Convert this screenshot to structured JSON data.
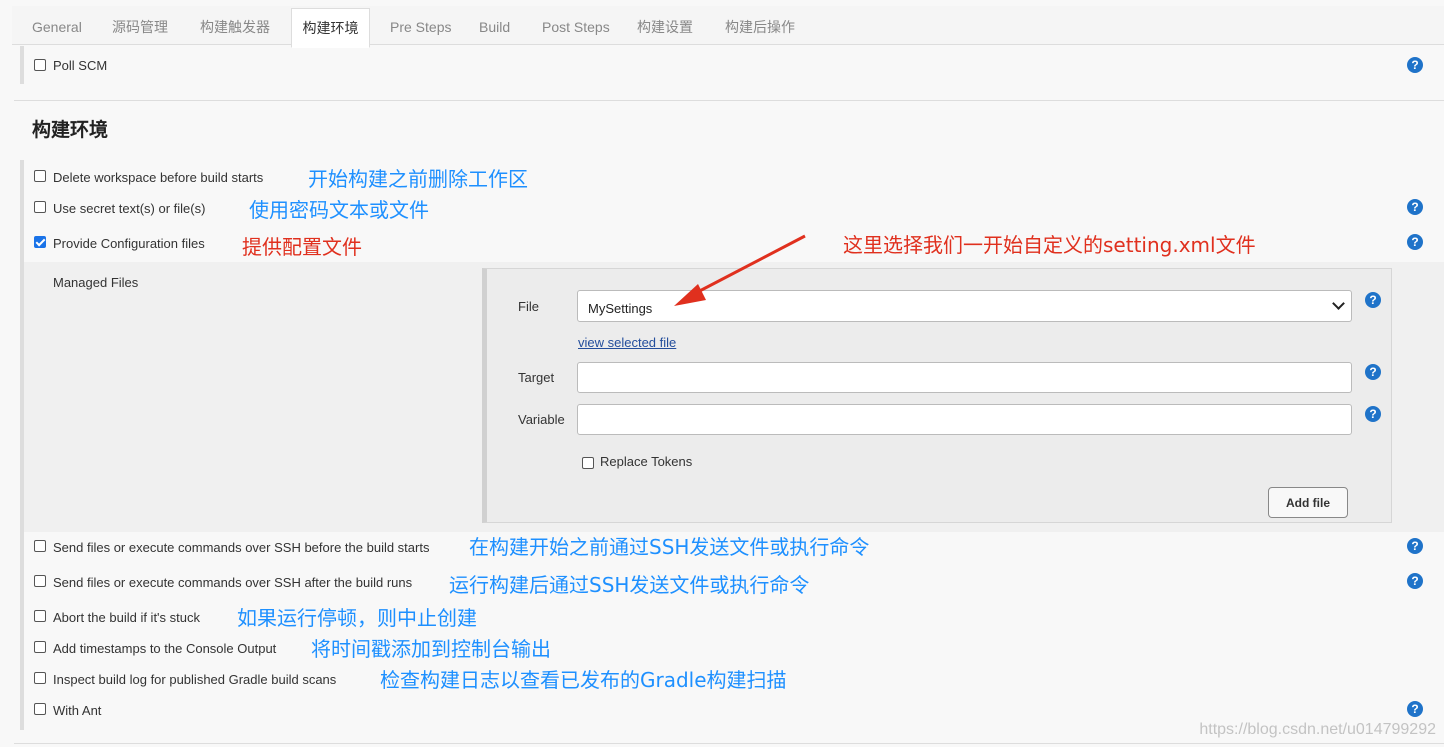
{
  "tabs": [
    "General",
    "源码管理",
    "构建触发器",
    "构建环境",
    "Pre Steps",
    "Build",
    "Post Steps",
    "构建设置",
    "构建后操作"
  ],
  "active_tab": "构建环境",
  "poll_scm": {
    "label": "Poll SCM",
    "checked": false
  },
  "section_title": "构建环境",
  "options": [
    {
      "label": "Delete workspace before build starts",
      "checked": false,
      "annotation": "开始构建之前删除工作区",
      "help": false
    },
    {
      "label": "Use secret text(s) or file(s)",
      "checked": false,
      "annotation": "使用密码文本或文件",
      "help": true
    },
    {
      "label": "Provide Configuration files",
      "checked": true,
      "annotation": "提供配置文件",
      "help": true
    },
    {
      "label": "Send files or execute commands over SSH before the build starts",
      "checked": false,
      "annotation": "在构建开始之前通过SSH发送文件或执行命令",
      "help": true
    },
    {
      "label": "Send files or execute commands over SSH after the build runs",
      "checked": false,
      "annotation": "运行构建后通过SSH发送文件或执行命令",
      "help": true
    },
    {
      "label": "Abort the build if it's stuck",
      "checked": false,
      "annotation": "如果运行停顿，则中止创建",
      "help": false
    },
    {
      "label": "Add timestamps to the Console Output",
      "checked": false,
      "annotation": "将时间戳添加到控制台输出",
      "help": false
    },
    {
      "label": "Inspect build log for published Gradle build scans",
      "checked": false,
      "annotation": "检查构建日志以查看已发布的Gradle构建扫描",
      "help": false
    },
    {
      "label": "With Ant",
      "checked": false,
      "annotation": "",
      "help": true
    }
  ],
  "managed": {
    "title": "Managed Files",
    "file_label": "File",
    "file_value": "MySettings",
    "view_link": "view selected file",
    "target_label": "Target",
    "target_value": "",
    "variable_label": "Variable",
    "variable_value": "",
    "replace_tokens_label": "Replace Tokens",
    "replace_tokens_checked": false,
    "add_file_label": "Add file"
  },
  "red_annotation": "这里选择我们一开始自定义的setting.xml文件",
  "help_glyph": "?",
  "watermark": "https://blog.csdn.net/u014799292",
  "colors": {
    "help": "#1f73c9",
    "annotation_blue": "#1e90ff",
    "annotation_red": "#e0301e",
    "checkbox_checked": "#1a73e8"
  }
}
